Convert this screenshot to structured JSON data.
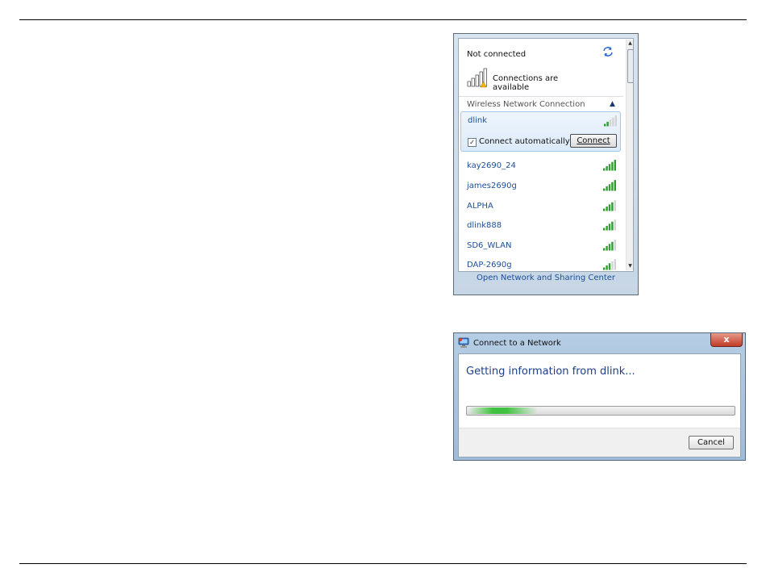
{
  "network_flyout": {
    "status": "Not connected",
    "connections_available": "Connections are available",
    "section_title": "Wireless Network Connection",
    "selected_network": {
      "name": "dlink",
      "connect_automatically_label": "Connect automatically",
      "connect_automatically_checked": true,
      "connect_button": "Connect",
      "signal_bars": 2
    },
    "networks": [
      {
        "name": "kay2690_24",
        "signal_bars": 5
      },
      {
        "name": "james2690g",
        "signal_bars": 5
      },
      {
        "name": "ALPHA",
        "signal_bars": 4
      },
      {
        "name": "dlink888",
        "signal_bars": 4
      },
      {
        "name": "SD6_WLAN",
        "signal_bars": 4
      },
      {
        "name": "DAP-2690g",
        "signal_bars": 3
      }
    ],
    "footer_link": "Open Network and Sharing Center"
  },
  "connect_dialog": {
    "title": "Connect to a Network",
    "close_symbol": "x",
    "message": "Getting information from dlink...",
    "progress_indeterminate": true,
    "cancel_button": "Cancel"
  },
  "colors": {
    "link_blue": "#1c4f96",
    "heading_blue": "#1e3f8a",
    "signal_green": "#2f9c2f",
    "progress_green": "#3fc23f"
  }
}
